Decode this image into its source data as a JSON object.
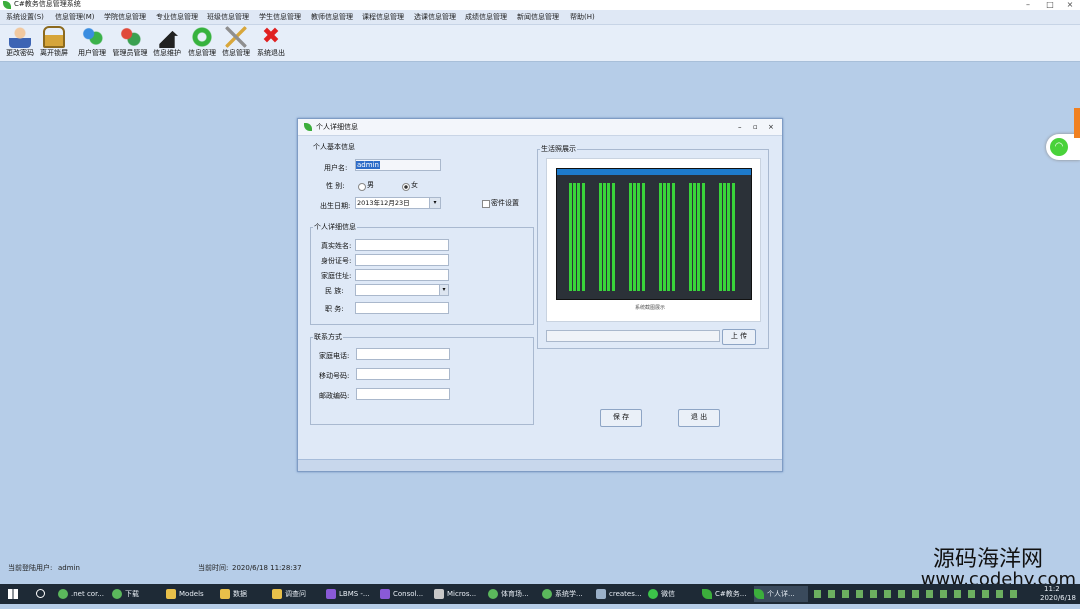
{
  "window": {
    "title": "C#教务信息管理系统"
  },
  "menubar": [
    "系统设置(S)",
    "信息管理(M)",
    "学院信息管理",
    "专业信息管理",
    "班级信息管理",
    "学生信息管理",
    "教师信息管理",
    "课程信息管理",
    "选课信息管理",
    "成绩信息管理",
    "新闻信息管理",
    "帮助(H)"
  ],
  "toolbar": [
    "更改密码",
    "离开锁屏",
    "用户管理",
    "管理员管理",
    "信息维护",
    "信息管理",
    "信息管理",
    "系统退出"
  ],
  "dialog": {
    "title": "个人详细信息",
    "basic": {
      "legend": "个人基本信息",
      "username_label": "用户名:",
      "username_value": "admin",
      "gender_label": "性  别:",
      "male": "男",
      "female": "女",
      "birth_label": "出生日期:",
      "birth_value": "2013年12月23日",
      "hide_label": "密件设置"
    },
    "detail": {
      "legend": "个人详细信息",
      "name_label": "真实姓名:",
      "id_label": "身份证号:",
      "address_label": "家庭住址:",
      "nation_label": "民  族:",
      "job_label": "职  务:"
    },
    "contact": {
      "legend": "联系方式",
      "phone_label": "家庭电话:",
      "mobile_label": "移动号码:",
      "email_label": "邮政编码:"
    },
    "photo": {
      "legend": "生活照展示",
      "caption": "系统截图展示",
      "upload": "上 传"
    },
    "buttons": {
      "save": "保 存",
      "exit": "退 出"
    }
  },
  "status": {
    "user_label": "当前登陆用户:",
    "user_value": "admin",
    "time_label": "当前时间:",
    "time_value": "2020/6/18 11:28:37"
  },
  "watermark": {
    "line1": "源码海洋网",
    "line2": "www.codehy.com"
  },
  "taskbar": {
    "items": [
      ".net cor...",
      "下载",
      "Models",
      "数据",
      "调查问",
      "LBMS -...",
      "Consol...",
      "Micros...",
      "体育场...",
      "系统学...",
      "creates...",
      "微信",
      "C#教务...",
      "个人详..."
    ],
    "clock_time": "11:2",
    "clock_date": "2020/6/18"
  },
  "colors": {
    "desktop": "#b6cde8",
    "accent": "#2e6cc8",
    "signal": "#49d23a"
  }
}
